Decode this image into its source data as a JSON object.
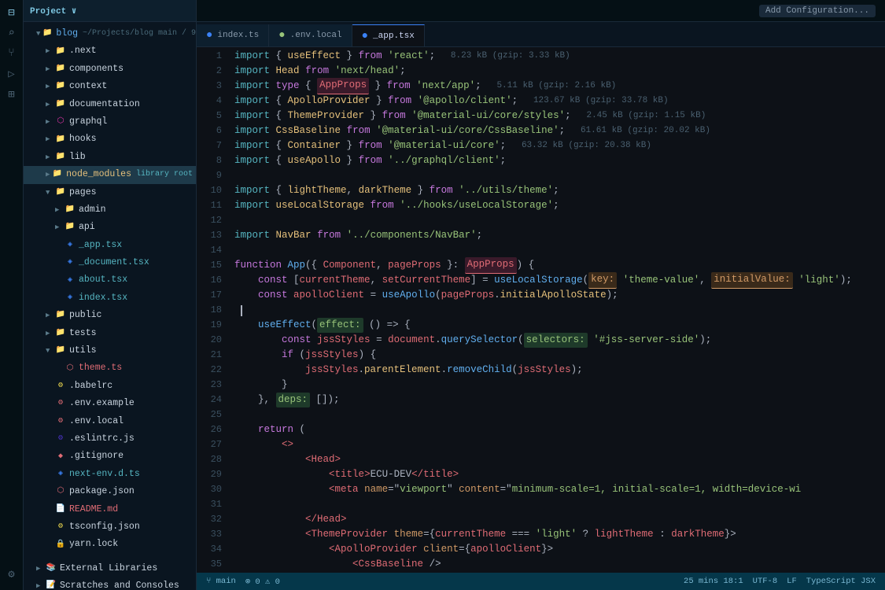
{
  "app": {
    "title": "Project",
    "branch": "main",
    "changes": "9△"
  },
  "tabs": {
    "items": [
      {
        "label": "index.ts",
        "type": "ts",
        "active": false
      },
      {
        "label": ".env.local",
        "type": "env",
        "active": false
      },
      {
        "label": "_app.tsx",
        "type": "tsx",
        "active": true
      }
    ]
  },
  "topbar": {
    "add_config": "Add Configuration..."
  },
  "filetree": {
    "project_label": "Project ∨",
    "blog_label": "blog",
    "path": "~/Projects/blog",
    "branch_info": "main / 9△"
  },
  "statusbar": {
    "branch": "main",
    "encoding": "UTF-8",
    "line_ending": "LF",
    "language": "TypeScript JSX",
    "position": "25 mins 18:1",
    "git_info": "Git"
  },
  "code": {
    "lines": [
      {
        "num": 1,
        "content": "import_useEffect_react"
      },
      {
        "num": 2,
        "content": "import_Head_next"
      },
      {
        "num": 3,
        "content": "import_AppProps_next_app"
      },
      {
        "num": 4,
        "content": "import_ApolloProvider_apollo"
      },
      {
        "num": 5,
        "content": "import_ThemeProvider_material"
      },
      {
        "num": 6,
        "content": "import_CssBaseline_material"
      },
      {
        "num": 7,
        "content": "import_Container_material"
      },
      {
        "num": 8,
        "content": "import_useApollo_graphql"
      },
      {
        "num": 9,
        "content": ""
      },
      {
        "num": 10,
        "content": "import_lightTheme_utils"
      },
      {
        "num": 11,
        "content": "import_useLocalStorage_hooks"
      },
      {
        "num": 12,
        "content": ""
      },
      {
        "num": 13,
        "content": "import_NavBar_components"
      },
      {
        "num": 14,
        "content": ""
      },
      {
        "num": 15,
        "content": "function_App"
      },
      {
        "num": 16,
        "content": "const_currentTheme"
      },
      {
        "num": 17,
        "content": "const_apolloClient"
      },
      {
        "num": 18,
        "content": ""
      },
      {
        "num": 19,
        "content": "useEffect_effect"
      },
      {
        "num": 20,
        "content": "const_jssStyles_querySelector"
      },
      {
        "num": 21,
        "content": "if_jssStyles"
      },
      {
        "num": 22,
        "content": "jssStyles_removeChild"
      },
      {
        "num": 23,
        "content": "close_brace"
      },
      {
        "num": 24,
        "content": "deps_array"
      },
      {
        "num": 25,
        "content": ""
      },
      {
        "num": 26,
        "content": "return_open"
      },
      {
        "num": 27,
        "content": "jsx_open"
      },
      {
        "num": 28,
        "content": "head_open"
      },
      {
        "num": 29,
        "content": "title_ecu"
      },
      {
        "num": 30,
        "content": "meta_viewport"
      },
      {
        "num": 31,
        "content": ""
      },
      {
        "num": 32,
        "content": "head_close"
      },
      {
        "num": 33,
        "content": "theme_provider_open"
      },
      {
        "num": 34,
        "content": "apollo_provider_open"
      },
      {
        "num": 35,
        "content": "css_baseline"
      }
    ]
  }
}
